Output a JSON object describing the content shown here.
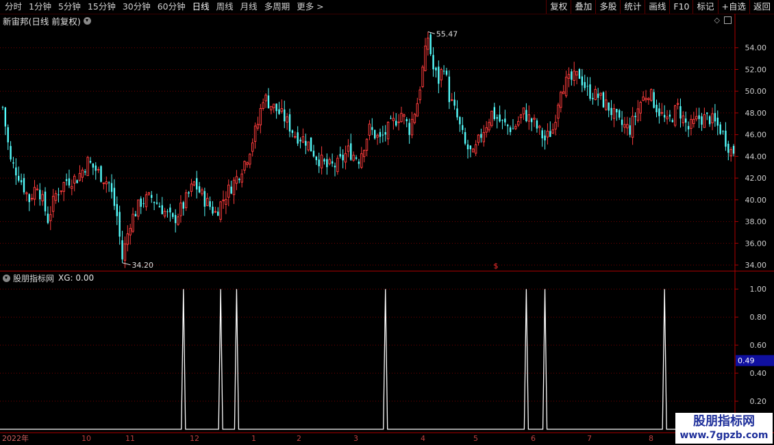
{
  "toolbar": {
    "periods": [
      "分时",
      "1分钟",
      "5分钟",
      "15分钟",
      "30分钟",
      "60分钟",
      "日线",
      "周线",
      "月线",
      "多周期",
      "更多 >"
    ],
    "active_period": "日线",
    "buttons": [
      "复权",
      "叠加",
      "多股",
      "统计",
      "画线",
      "F10",
      "标记",
      "+自选",
      "返回"
    ]
  },
  "stock_title": "新宙邦(日线 前复权)",
  "indicator": {
    "name": "股朋指标网",
    "xg_label": "XG: 0.00",
    "cursor_value": "0.49"
  },
  "watermark": {
    "line1": "股朋指标网",
    "line2": "www.7gpzb.com"
  },
  "colors": {
    "background": "#000000",
    "up": "#ff3c3c",
    "down": "#54fcfc",
    "grid": "#7a0000",
    "axis": "#b00000",
    "signal": "#ffffff"
  },
  "chart_data": [
    {
      "type": "candlestick",
      "title": "新宙邦(日线 前复权)",
      "ylim": [
        33.5,
        56
      ],
      "y_ticks": [
        "54.00",
        "52.00",
        "50.00",
        "48.00",
        "46.00",
        "44.00",
        "42.00",
        "40.00",
        "38.00",
        "36.00",
        "34.00"
      ],
      "annotations": [
        {
          "label": "55.47",
          "value": 55.47
        },
        {
          "label": "34.20",
          "value": 34.2
        }
      ],
      "x_ticks": [
        "2022年",
        "10",
        "11",
        "12",
        "1",
        "2",
        "3",
        "4",
        "5",
        "6",
        "7",
        "8"
      ],
      "series_close_anchors": [
        [
          0,
          48.5
        ],
        [
          3,
          43.5
        ],
        [
          6,
          42.3
        ],
        [
          10,
          40.0
        ],
        [
          13,
          41.5
        ],
        [
          17,
          38.2
        ],
        [
          20,
          40.5
        ],
        [
          24,
          41.8
        ],
        [
          28,
          42.0
        ],
        [
          32,
          43.5
        ],
        [
          36,
          42.5
        ],
        [
          40,
          41.5
        ],
        [
          43,
          38.5
        ],
        [
          45,
          34.6
        ],
        [
          48,
          38.0
        ],
        [
          52,
          39.8
        ],
        [
          56,
          40.2
        ],
        [
          60,
          39.2
        ],
        [
          64,
          38.0
        ],
        [
          68,
          39.5
        ],
        [
          72,
          41.5
        ],
        [
          76,
          40.0
        ],
        [
          80,
          38.8
        ],
        [
          84,
          40.5
        ],
        [
          88,
          42.0
        ],
        [
          92,
          44.0
        ],
        [
          96,
          47.0
        ],
        [
          98,
          49.5
        ],
        [
          102,
          48.5
        ],
        [
          106,
          47.5
        ],
        [
          110,
          46.0
        ],
        [
          114,
          45.5
        ],
        [
          118,
          44.0
        ],
        [
          122,
          43.0
        ],
        [
          126,
          43.2
        ],
        [
          130,
          44.5
        ],
        [
          134,
          43.8
        ],
        [
          138,
          46.5
        ],
        [
          142,
          45.5
        ],
        [
          146,
          46.8
        ],
        [
          150,
          48.0
        ],
        [
          153,
          46.5
        ],
        [
          156,
          49.0
        ],
        [
          158,
          52.0
        ],
        [
          160,
          55.0
        ],
        [
          162,
          52.0
        ],
        [
          164,
          51.0
        ],
        [
          166,
          52.5
        ],
        [
          168,
          49.5
        ],
        [
          171,
          47.5
        ],
        [
          174,
          45.0
        ],
        [
          177,
          44.0
        ],
        [
          180,
          46.0
        ],
        [
          184,
          48.0
        ],
        [
          188,
          47.0
        ],
        [
          192,
          46.5
        ],
        [
          196,
          48.0
        ],
        [
          200,
          47.0
        ],
        [
          204,
          45.5
        ],
        [
          207,
          46.5
        ],
        [
          210,
          50.5
        ],
        [
          214,
          51.0
        ],
        [
          217,
          51.5
        ],
        [
          220,
          50.0
        ],
        [
          224,
          49.5
        ],
        [
          228,
          48.5
        ],
        [
          232,
          47.0
        ],
        [
          236,
          46.5
        ],
        [
          240,
          49.0
        ],
        [
          243,
          50.0
        ],
        [
          246,
          48.5
        ],
        [
          250,
          47.0
        ],
        [
          254,
          48.5
        ],
        [
          258,
          46.5
        ],
        [
          262,
          47.5
        ],
        [
          266,
          47.5
        ],
        [
          270,
          46.5
        ],
        [
          274,
          44.5
        ]
      ]
    },
    {
      "type": "line",
      "name": "XG",
      "ylim": [
        0,
        1.05
      ],
      "y_ticks": [
        "1.00",
        "0.80",
        "0.60",
        "0.40",
        "0.20"
      ],
      "spikes_at_bar": [
        68,
        82,
        88,
        144,
        197,
        204,
        249
      ],
      "spike_value": 1.0,
      "baseline_value": 0.0
    }
  ]
}
